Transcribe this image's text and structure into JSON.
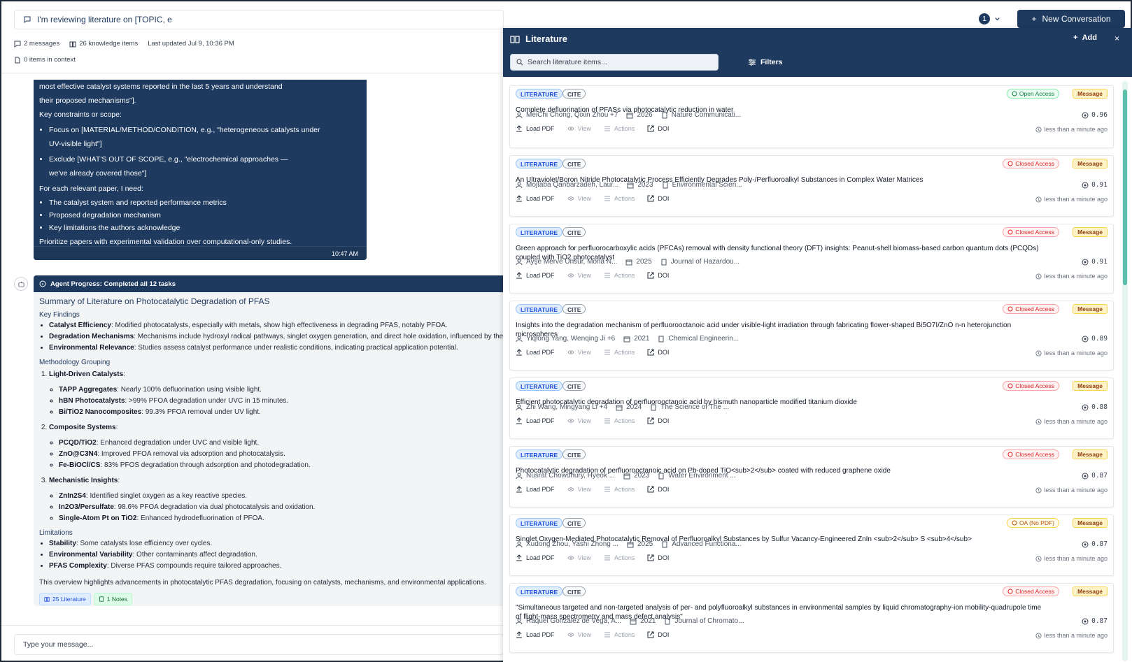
{
  "conversation": {
    "title": "I'm reviewing literature on [TOPIC, e",
    "badge_count": "1",
    "new_button": "New Conversation",
    "messages_count": "2 messages",
    "knowledge_items": "26 knowledge items",
    "last_updated": "Last updated Jul 9, 10:36 PM",
    "context_items": "0 items in context",
    "input_placeholder": "Type your message..."
  },
  "user_message": {
    "line1": "most effective catalyst systems reported in the last 5 years and understand",
    "line2": "their proposed mechanisms\"].",
    "constraints_heading": "Key constraints or scope:",
    "constraint1a": "Focus on [MATERIAL/METHOD/CONDITION, e.g., \"heterogeneous catalysts under",
    "constraint1b": "UV-visible light\"]",
    "constraint2a": "Exclude [WHAT'S OUT OF SCOPE, e.g., \"electrochemical approaches —",
    "constraint2b": "we've already covered those\"]",
    "need_heading": "For each relevant paper, I need:",
    "need1": "The catalyst system and reported performance metrics",
    "need2": "Proposed degradation mechanism",
    "need3": "Key limitations the authors acknowledge",
    "priority": "Prioritize papers with experimental validation over computational-only studies.",
    "time": "10:47 AM"
  },
  "agent": {
    "progress": "Agent Progress: Completed all 12 tasks",
    "title": "Summary of Literature on Photocatalytic Degradation of PFAS",
    "key_findings": "Key Findings",
    "kf1_b": "Catalyst Efficiency",
    "kf1_t": ": Modified photocatalysts, especially with metals, show high effectiveness in degrading PFAS, notably PFOA.",
    "kf2_b": "Degradation Mechanisms",
    "kf2_t": ": Mechanisms include hydroxyl radical pathways, singlet oxygen generation, and direct hole oxidation, influenced by the p",
    "kf3_b": "Environmental Relevance",
    "kf3_t": ": Studies assess catalyst performance under realistic conditions, indicating practical application potential.",
    "method_heading": "Methodology Grouping",
    "g1": "Light-Driven Catalysts",
    "g1a_b": "TAPP Aggregates",
    "g1a_t": ": Nearly 100% defluorination using visible light.",
    "g1b_b": "hBN Photocatalysts",
    "g1b_t": ": >99% PFOA degradation under UVC in 15 minutes.",
    "g1c_b": "Bi/TiO2 Nanocomposites",
    "g1c_t": ": 99.3% PFOA removal under UV light.",
    "g2": "Composite Systems",
    "g2a_b": "PCQD/TiO2",
    "g2a_t": ": Enhanced degradation under UVC and visible light.",
    "g2b_b": "ZnO@C3N4",
    "g2b_t": ": Improved PFOA removal via adsorption and photocatalysis.",
    "g2c_b": "Fe-BiOCl/CS",
    "g2c_t": ": 83% PFOS degradation through adsorption and photodegradation.",
    "g3": "Mechanistic Insights",
    "g3a_b": "ZnIn2S4",
    "g3a_t": ": Identified singlet oxygen as a key reactive species.",
    "g3b_b": "In2O3/Persulfate",
    "g3b_t": ": 98.6% PFOA degradation via dual photocatalysis and oxidation.",
    "g3c_b": "Single-Atom Pt on TiO2",
    "g3c_t": ": Enhanced hydrodefluorination of PFOA.",
    "limitations": "Limitations",
    "l1_b": "Stability",
    "l1_t": ": Some catalysts lose efficiency over cycles.",
    "l2_b": "Environmental Variability",
    "l2_t": ": Other contaminants affect degradation.",
    "l3_b": "PFAS Complexity",
    "l3_t": ": Diverse PFAS compounds require tailored approaches.",
    "overview": "This overview highlights advancements in photocatalytic PFAS degradation, focusing on catalysts, mechanisms, and environmental applications.",
    "chip_lit": "25 Literature",
    "chip_notes": "1 Notes"
  },
  "literature": {
    "title": "Literature",
    "add": "Add",
    "close": "×",
    "search_placeholder": "Search literature items...",
    "filters": "Filters",
    "tag_lit": "LITERATURE",
    "tag_cite": "CITE",
    "message": "Message",
    "load_pdf": "Load PDF",
    "view": "View",
    "actions": "Actions",
    "doi": "DOI",
    "ago": "less than a minute ago",
    "items": [
      {
        "access": "Open Access",
        "access_type": "open",
        "title": "Complete defluorination of PFASs via photocatalytic reduction in water",
        "authors": "MeiChi Chong, Qixin Zhou +7",
        "year": "2026",
        "journal": "Nature Communicati...",
        "score": "0.96"
      },
      {
        "access": "Closed Access",
        "access_type": "closed",
        "title": "An Ultraviolet/Boron Nitride Photocatalytic Process Efficiently Degrades Poly-/Perfluoroalkyl Substances in Complex Water Matrices",
        "authors": "Mojtaba Qanbarzadeh, Laur...",
        "year": "2023",
        "journal": "Environmental Scien...",
        "score": "0.91"
      },
      {
        "access": "Closed Access",
        "access_type": "closed",
        "title": "Green approach for perfluorocarboxylic acids (PFCAs) removal with density functional theory (DFT) insights: Peanut-shell biomass-based carbon quantum dots (PCQDs) coupled with TiO2 photocatalyst",
        "authors": "Ayşe Merve Ünsür, Mona N...",
        "year": "2025",
        "journal": "Journal of Hazardou...",
        "score": "0.91"
      },
      {
        "access": "Closed Access",
        "access_type": "closed",
        "title": "Insights into the degradation mechanism of perfluorooctanoic acid under visible-light irradiation through fabricating flower-shaped Bi5O7I/ZnO n-n heterojunction microspheres",
        "authors": "Yiqiong Yang, Wenqing Ji +6",
        "year": "2021",
        "journal": "Chemical Engineerin...",
        "score": "0.89"
      },
      {
        "access": "Closed Access",
        "access_type": "closed",
        "title": "Efficient photocatalytic degradation of perfluorooctanoic acid by bismuth nanoparticle modified titanium dioxide",
        "authors": "Zhi Wang, Mingyang Li +4",
        "year": "2024",
        "journal": "The Science of The ...",
        "score": "0.88"
      },
      {
        "access": "Closed Access",
        "access_type": "closed",
        "title": "Photocatalytic degradation of perfluorooctanoic acid on Pb-doped TiO<sub>2</sub> coated with reduced graphene oxide",
        "authors": "Nusrat Chowdhury, Hyeok ...",
        "year": "2023",
        "journal": "Water Environment ...",
        "score": "0.87"
      },
      {
        "access": "OA (No PDF)",
        "access_type": "oa",
        "title": "Singlet Oxygen-Mediated Photocatalytic Removal of Perfluoroalkyl Substances by Sulfur Vacancy-Engineered ZnIn <sub>2</sub> S <sub>4</sub>",
        "authors": "Xudong Zhou, Yashi Zhong ...",
        "year": "2025",
        "journal": "Advanced Functiona...",
        "score": "0.87"
      },
      {
        "access": "Closed Access",
        "access_type": "closed",
        "title": "\"Simultaneous targeted and non-targeted analysis of per- and polyfluoroalkyl substances in environmental samples by liquid chromatography-ion mobility-quadrupole time of flight-mass spectrometry and mass defect analysis\"",
        "authors": "Raquel Gonzalez de Vega, A...",
        "year": "2021",
        "journal": "Journal of Chromato...",
        "score": "0.87"
      }
    ]
  }
}
